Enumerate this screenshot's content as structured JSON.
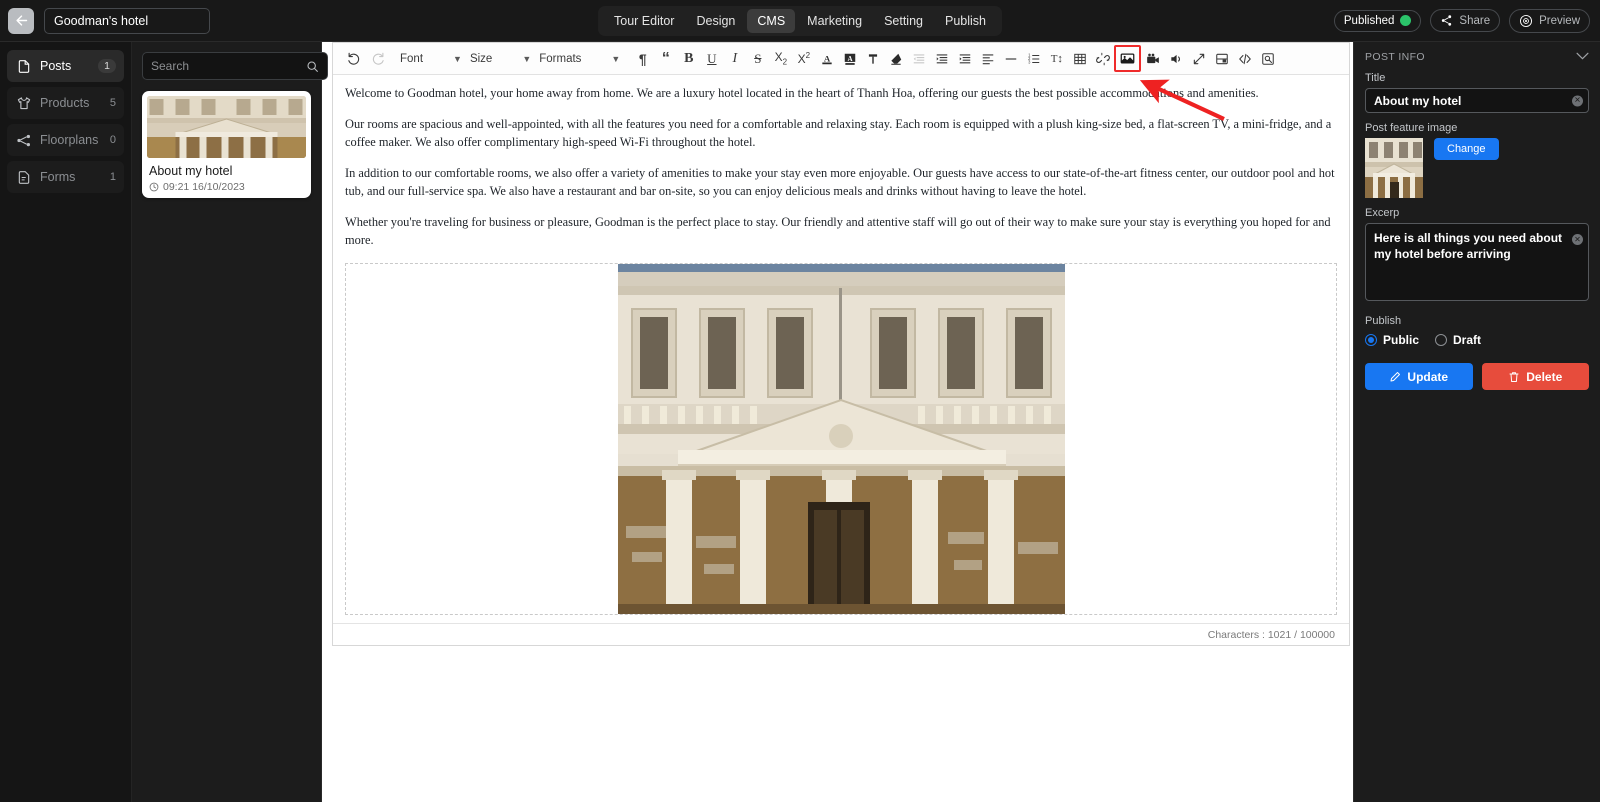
{
  "topbar": {
    "back_icon": "arrow-left-icon",
    "project_title": "Goodman's hotel",
    "nav": [
      {
        "label": "Tour Editor",
        "active": false
      },
      {
        "label": "Design",
        "active": false
      },
      {
        "label": "CMS",
        "active": true
      },
      {
        "label": "Marketing",
        "active": false
      },
      {
        "label": "Setting",
        "active": false
      },
      {
        "label": "Publish",
        "active": false
      }
    ],
    "status_label": "Published",
    "status_color": "#2bc46a",
    "share_label": "Share",
    "preview_label": "Preview"
  },
  "sidebar": {
    "items": [
      {
        "label": "Posts",
        "count": "1",
        "icon": "document-icon",
        "selected": true
      },
      {
        "label": "Products",
        "count": "5",
        "icon": "tshirt-icon",
        "selected": false
      },
      {
        "label": "Floorplans",
        "count": "0",
        "icon": "sitemap-icon",
        "selected": false
      },
      {
        "label": "Forms",
        "count": "1",
        "icon": "form-icon",
        "selected": false
      }
    ]
  },
  "list_panel": {
    "search_placeholder": "Search",
    "search_value": "",
    "search_icon": "search-icon",
    "add_icon": "plus-icon",
    "posts": [
      {
        "title": "About my hotel",
        "date": "09:21 16/10/2023",
        "clock_icon": "clock-icon"
      }
    ]
  },
  "toolbar": {
    "undo": "undo-icon",
    "redo": "redo-icon",
    "font_label": "Font",
    "size_label": "Size",
    "formats_label": "Formats",
    "items": [
      {
        "name": "paragraph-icon",
        "glyph": "¶"
      },
      {
        "name": "blockquote-icon",
        "glyph": "“"
      },
      {
        "name": "bold-icon",
        "glyph": "B"
      },
      {
        "name": "underline-icon",
        "glyph": "U"
      },
      {
        "name": "italic-icon",
        "glyph": "I"
      },
      {
        "name": "strikethrough-icon",
        "glyph": "S"
      },
      {
        "name": "subscript-icon",
        "glyph": "X₂"
      },
      {
        "name": "superscript-icon",
        "glyph": "X²"
      },
      {
        "name": "text-color-icon",
        "glyph": "A"
      },
      {
        "name": "background-color-icon",
        "glyph": "A"
      },
      {
        "name": "format-painter-icon",
        "glyph": "T"
      },
      {
        "name": "clear-formatting-icon",
        "glyph": "eraser"
      },
      {
        "name": "outdent-icon",
        "glyph": "outdent"
      },
      {
        "name": "indent-icon",
        "glyph": "indent"
      },
      {
        "name": "align-icon",
        "glyph": "align"
      },
      {
        "name": "horizontal-rule-icon",
        "glyph": "—"
      },
      {
        "name": "ordered-list-icon",
        "glyph": "list"
      },
      {
        "name": "line-height-icon",
        "glyph": "T↕"
      },
      {
        "name": "table-icon",
        "glyph": "table"
      },
      {
        "name": "unlink-icon",
        "glyph": "unlink"
      },
      {
        "name": "insert-image-icon",
        "glyph": "image",
        "highlighted": true
      },
      {
        "name": "insert-video-icon",
        "glyph": "video"
      },
      {
        "name": "insert-audio-icon",
        "glyph": "audio"
      },
      {
        "name": "fullscreen-icon",
        "glyph": "expand"
      },
      {
        "name": "page-break-icon",
        "glyph": "pagebreak"
      },
      {
        "name": "source-code-icon",
        "glyph": "</>"
      },
      {
        "name": "preview-icon",
        "glyph": "preview"
      }
    ]
  },
  "document": {
    "paragraphs": [
      "Welcome to Goodman hotel, your home away from home. We are a luxury hotel located in the heart of  Thanh Hoa, offering our guests the best possible accommodations and amenities.",
      "Our rooms are spacious and well-appointed, with all the features you need for a comfortable and relaxing stay. Each room is equipped with a plush king-size bed, a flat-screen TV, a mini-fridge, and a coffee maker. We also offer complimentary high-speed Wi-Fi throughout the hotel.",
      "In addition to our comfortable rooms, we also offer a variety of amenities to make your stay even more enjoyable. Our guests have access to our state-of-the-art fitness center, our outdoor pool and hot tub, and our full-service spa. We also have a restaurant and bar on-site, so you can enjoy delicious meals and drinks without having to leave the hotel.",
      "Whether you're traveling for business or pleasure, Goodman is the perfect place to stay. Our friendly and attentive staff will go out of their way to make sure your stay is everything you hoped for and more."
    ],
    "status_text": "Characters : 1021 / 100000"
  },
  "right_panel": {
    "section_title": "POST INFO",
    "collapse_icon": "chevron-down-icon",
    "title_label": "Title",
    "title_value": "About my hotel",
    "feature_image_label": "Post feature image",
    "change_label": "Change",
    "excerpt_label": "Excerp",
    "excerpt_value": "Here is all things you need about my hotel before arriving",
    "publish_label": "Publish",
    "publish_options": [
      {
        "label": "Public",
        "selected": true
      },
      {
        "label": "Draft",
        "selected": false
      }
    ],
    "update_label": "Update",
    "update_icon": "pencil-icon",
    "delete_label": "Delete",
    "delete_icon": "trash-icon",
    "accent_color": "#1877f2",
    "danger_color": "#e74c3c"
  },
  "annotation": {
    "arrow_color": "#ee2222",
    "highlight_color": "#ef2b2b"
  }
}
